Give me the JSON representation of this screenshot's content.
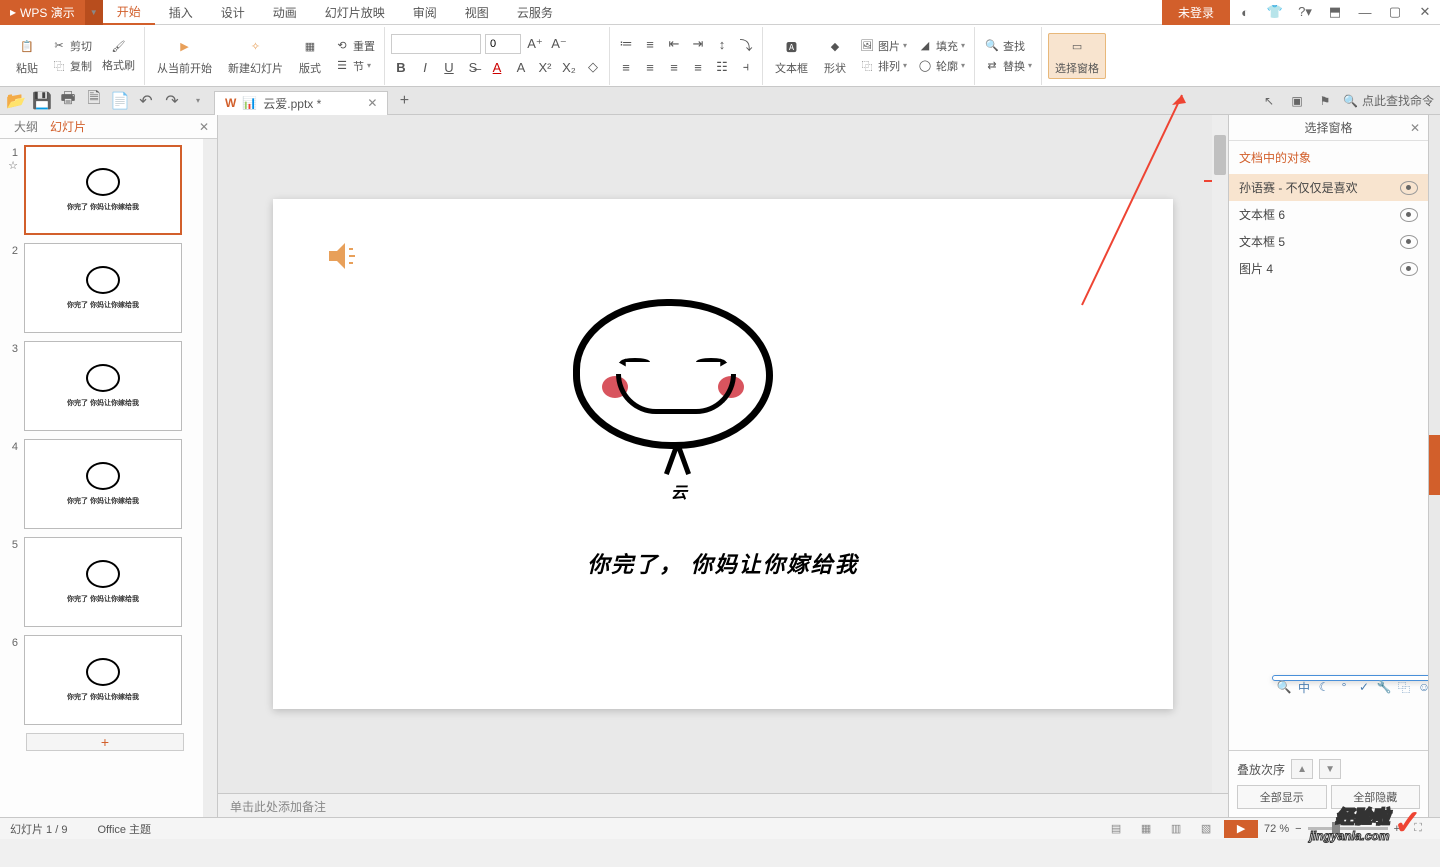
{
  "app": {
    "name": "WPS 演示",
    "login": "未登录"
  },
  "tabs": [
    "开始",
    "插入",
    "设计",
    "动画",
    "幻灯片放映",
    "审阅",
    "视图",
    "云服务"
  ],
  "active_tab": 0,
  "ribbon": {
    "paste": "粘贴",
    "cut": "剪切",
    "copy": "复制",
    "format_painter": "格式刷",
    "from_current": "从当前开始",
    "new_slide": "新建幻灯片",
    "layout": "版式",
    "reset": "重置",
    "section": "节",
    "font_name": "",
    "font_size": "0",
    "textbox": "文本框",
    "shape": "形状",
    "arrange": "排列",
    "outline": "轮廓",
    "picture": "图片",
    "fill": "填充",
    "find": "查找",
    "replace": "替换",
    "select_pane": "选择窗格"
  },
  "qat_search": "点此查找命令",
  "doc": {
    "name": "云爱.pptx *"
  },
  "left": {
    "tab_outline": "大纲",
    "tab_slides": "幻灯片"
  },
  "slide": {
    "char": "云",
    "caption": "你完了， 你妈让你嫁给我"
  },
  "thumb_captions": [
    "你完了 你妈让你嫁给我",
    "你完了 你妈让你嫁给我",
    "你完了 你妈让你嫁给我",
    "你完了 你妈让你嫁给我",
    "你完了 你妈让你嫁给我",
    "你完了 你妈让你嫁给我"
  ],
  "notes_placeholder": "单击此处添加备注",
  "selection": {
    "title": "选择窗格",
    "section": "文档中的对象",
    "items": [
      "孙语赛 - 不仅仅是喜欢",
      "文本框 6",
      "文本框 5",
      "图片 4"
    ],
    "order": "叠放次序",
    "show_all": "全部显示",
    "hide_all": "全部隐藏"
  },
  "status": {
    "slide_count": "幻灯片 1 / 9",
    "theme": "Office 主题",
    "zoom": "72 %"
  },
  "watermark": {
    "cn": "经验啦",
    "en": "jingyanla.com"
  }
}
